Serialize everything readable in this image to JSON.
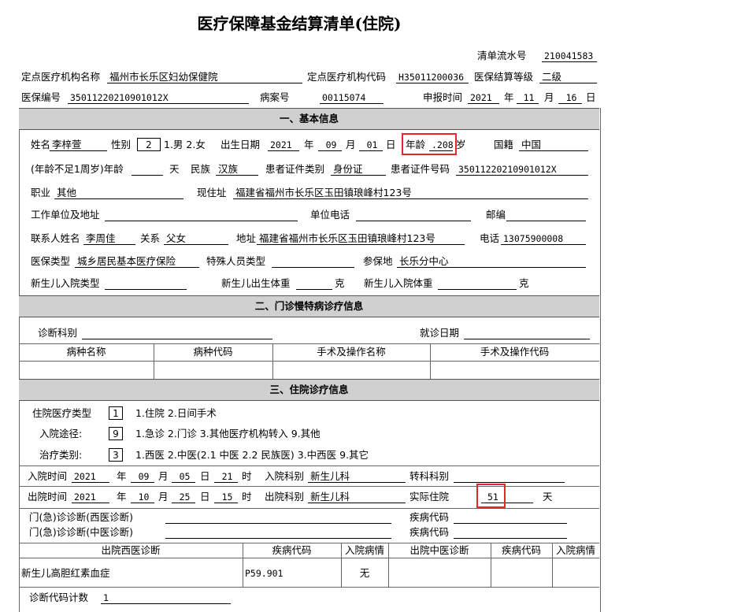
{
  "title": "医疗保障基金结算清单(住院)",
  "header": {
    "serial_label": "清单流水号",
    "serial_value": "210041583",
    "org_name_label": "定点医疗机构名称",
    "org_name_value": "福州市长乐区妇幼保健院",
    "org_code_label": "定点医疗机构代码",
    "org_code_value": "H35011200036",
    "level_label": "医保结算等级",
    "level_value": "二级",
    "insurance_no_label": "医保编号",
    "insurance_no_value": "35011220210901012X",
    "record_no_label": "病案号",
    "record_no_value": "00115074",
    "report_label": "申报时间",
    "report_year": "2021",
    "year_unit": "年",
    "report_month": "11",
    "month_unit": "月",
    "report_day": "16",
    "day_unit": "日"
  },
  "section1": {
    "heading": "一、基本信息",
    "name_label": "姓名",
    "name_value": "李梓萱",
    "gender_label": "性别",
    "gender_value": "2",
    "gender_options": "1.男 2.女",
    "birth_label": "出生日期",
    "birth_year": "2021",
    "birth_month": "09",
    "birth_day": "01",
    "age_label": "年龄",
    "age_value": ".208",
    "age_unit": "岁",
    "nationality_label": "国籍",
    "nationality_value": "中国",
    "infant_age_label": "(年龄不足1周岁)年龄",
    "infant_age_unit": "天",
    "ethnicity_label": "民族",
    "ethnicity_value": "汉族",
    "id_type_label": "患者证件类别",
    "id_type_value": "身份证",
    "id_no_label": "患者证件号码",
    "id_no_value": "35011220210901012X",
    "job_label": "职业",
    "job_value": "其他",
    "address_label": "现住址",
    "address_value": "福建省福州市长乐区玉田镇琅峰村123号",
    "work_label": "工作单位及地址",
    "work_phone_label": "单位电话",
    "zip_label": "邮编",
    "contact_label": "联系人姓名",
    "contact_value": "李周佳",
    "relation_label": "关系",
    "relation_value": "父女",
    "contact_addr_label": "地址",
    "contact_addr_value": "福建省福州市长乐区玉田镇琅峰村123号",
    "phone_label": "电话",
    "phone_value": "13075900008",
    "ins_type_label": "医保类型",
    "ins_type_value": "城乡居民基本医疗保险",
    "special_label": "特殊人员类型",
    "insured_place_label": "参保地",
    "insured_place_value": "长乐分中心",
    "newborn_type_label": "新生儿入院类型",
    "newborn_birth_weight_label": "新生儿出生体重",
    "weight_unit": "克",
    "newborn_adm_weight_label": "新生儿入院体重"
  },
  "section2": {
    "heading": "二、门诊慢特病诊疗信息",
    "dept_label": "诊断科别",
    "date_label": "就诊日期",
    "columns": [
      "病种名称",
      "病种代码",
      "手术及操作名称",
      "手术及操作代码"
    ]
  },
  "section3": {
    "heading": "三、住院诊疗信息",
    "type_label": "住院医疗类型",
    "type_value": "1",
    "type_options": "1.住院 2.日间手术",
    "route_label": "入院途径:",
    "route_value": "9",
    "route_options": "1.急诊 2.门诊 3.其他医疗机构转入 9.其他",
    "treat_label": "治疗类别:",
    "treat_value": "3",
    "treat_options": "1.西医 2.中医(2.1 中医 2.2 民族医) 3.中西医 9.其它",
    "adm_label": "入院时间",
    "adm_year": "2021",
    "adm_month": "09",
    "adm_day": "05",
    "adm_hour": "21",
    "hour_unit": "时",
    "adm_dept_label": "入院科别",
    "adm_dept_value": "新生儿科",
    "transfer_label": "转科科别",
    "dis_label": "出院时间",
    "dis_year": "2021",
    "dis_month": "10",
    "dis_day": "25",
    "dis_hour": "15",
    "dis_dept_label": "出院科别",
    "dis_dept_value": "新生儿科",
    "stay_label": "实际住院",
    "stay_value": "51",
    "stay_unit": "天",
    "op_west_label": "门(急)诊诊断(西医诊断)",
    "op_tcm_label": "门(急)诊诊断(中医诊断)",
    "disease_code_label": "疾病代码",
    "diag_columns": [
      "出院西医诊断",
      "疾病代码",
      "入院病情",
      "出院中医诊断",
      "疾病代码",
      "入院病情"
    ],
    "diag_rows": [
      {
        "west": "新生儿高胆红素血症",
        "code": "P59.901",
        "condition": "无",
        "tcm": "",
        "tcm_code": "",
        "tcm_condition": ""
      }
    ],
    "diag_count_label": "诊断代码计数",
    "diag_count_value": "1"
  }
}
